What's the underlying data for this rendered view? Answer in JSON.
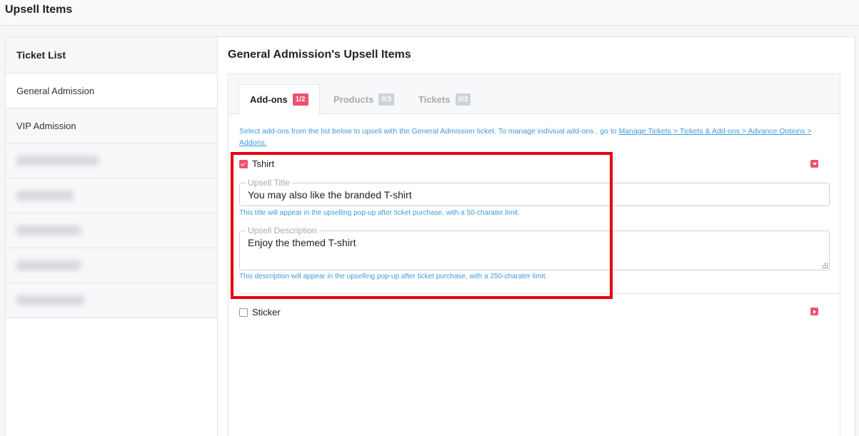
{
  "page": {
    "title": "Upsell Items"
  },
  "sidebar": {
    "header": "Ticket List",
    "items": [
      {
        "label": "General Admission",
        "active": true
      },
      {
        "label": "VIP Admission",
        "active": false
      }
    ]
  },
  "main": {
    "title": "General Admission's Upsell Items",
    "tabs": [
      {
        "label": "Add-ons",
        "badge": "1/2",
        "active": true
      },
      {
        "label": "Products",
        "badge": "0/3",
        "active": false
      },
      {
        "label": "Tickets",
        "badge": "0/3",
        "active": false
      }
    ],
    "helper_text": "Select add-ons from the list below to upsell with the General Admission ticket. To manage indiviual add-ons , go to ",
    "helper_link": "Manage Tickets > Tickets & Add-ons > Advance Options > Addons."
  },
  "addons": [
    {
      "name": "Tshirt",
      "checked": true,
      "title_legend": "Upsell Title",
      "title_value": "You may also like the branded T-shirt",
      "title_note": "This title will appear in the upselling pop-up after ticket purchase, with a 50-charater limit.",
      "desc_legend": "Upsell Description",
      "desc_value": "Enjoy the themed T-shirt",
      "desc_note": "This description will appear in the upselling pop-up after ticket purchase, with a 250-charater limit."
    },
    {
      "name": "Sticker",
      "checked": false
    }
  ],
  "colors": {
    "accent": "#f0506e",
    "link": "#3d9bdc",
    "highlight": "#e60012"
  }
}
